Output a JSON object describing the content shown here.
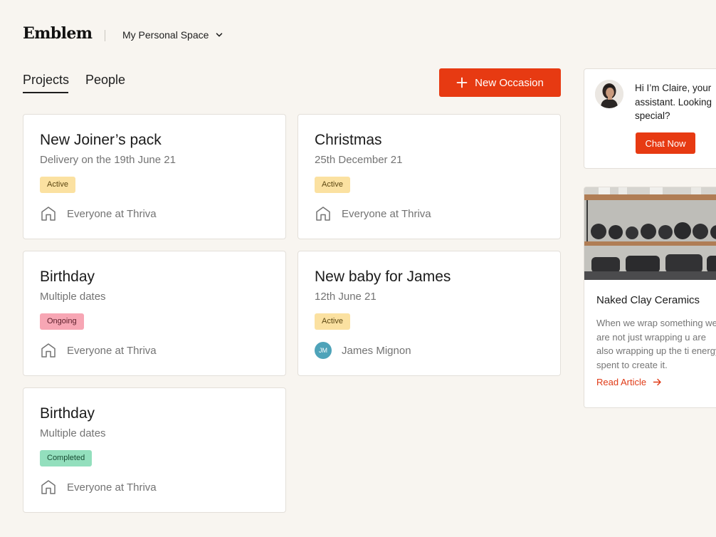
{
  "header": {
    "logo": "Emblem",
    "space_label": "My Personal Space",
    "space_icon": "chevron-down-icon"
  },
  "tabs": [
    {
      "label": "Projects",
      "active": true
    },
    {
      "label": "People",
      "active": false
    }
  ],
  "new_occasion": {
    "label": "New Occasion",
    "icon": "plus-icon"
  },
  "colors": {
    "background": "#f8f5f0",
    "accent": "#e73a12",
    "badge_active": "#fbe1a1",
    "badge_ongoing": "#f7a6b4",
    "badge_completed": "#93dfbd",
    "avatar_jm": "#4ea3b9"
  },
  "projects": [
    {
      "title": "New Joiner’s pack",
      "subtitle": "Delivery on the 19th June 21",
      "status": "Active",
      "owner": "Everyone at Thriva",
      "owner_icon": "home-icon"
    },
    {
      "title": "Christmas",
      "subtitle": "25th December 21",
      "status": "Active",
      "owner": "Everyone at Thriva",
      "owner_icon": "home-icon"
    },
    {
      "title": "Birthday",
      "subtitle": "Multiple dates",
      "status": "Ongoing",
      "owner": "Everyone at Thriva",
      "owner_icon": "home-icon"
    },
    {
      "title": "New baby for James",
      "subtitle": "12th June 21",
      "status": "Active",
      "owner": "James Mignon",
      "owner_initials": "JM"
    },
    {
      "title": "Birthday",
      "subtitle": "Multiple dates",
      "status": "Completed",
      "owner": "Everyone at Thriva",
      "owner_icon": "home-icon"
    }
  ],
  "chat": {
    "message": "Hi I’m Claire, your assistant. Looking special?",
    "button_label": "Chat Now"
  },
  "article": {
    "title": "Naked Clay Ceramics",
    "body": "When we wrap something we are not just wrapping u are also wrapping up the ti energy spent to create it.",
    "link_label": "Read Article",
    "link_icon": "arrow-right-icon"
  }
}
